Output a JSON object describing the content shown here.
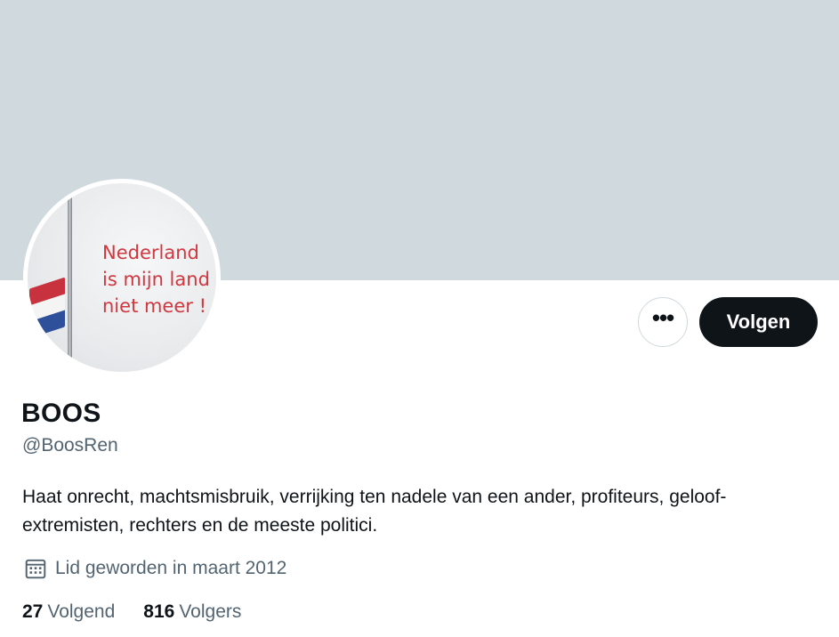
{
  "colors": {
    "banner": "#cfd9de",
    "primary_text": "#0f1419",
    "secondary_text": "#536471",
    "avatar_text": "#d0373f"
  },
  "avatar": {
    "lines": [
      "Nederland",
      "is mijn land",
      "niet meer !"
    ]
  },
  "actions": {
    "more_icon": "more-horizontal-icon",
    "more_glyph": "•••",
    "follow_label": "Volgen"
  },
  "profile": {
    "name": "BOOS",
    "handle": "@BoosRen",
    "bio": "Haat onrecht, machtsmisbruik, verrijking ten nadele van een ander, profiteurs, geloof-extremisten, rechters en de meeste politici.",
    "joined_icon": "calendar-icon",
    "joined": "Lid geworden in maart 2012"
  },
  "stats": {
    "following": {
      "count": "27",
      "label": "Volgend"
    },
    "followers": {
      "count": "816",
      "label": "Volgers"
    }
  }
}
